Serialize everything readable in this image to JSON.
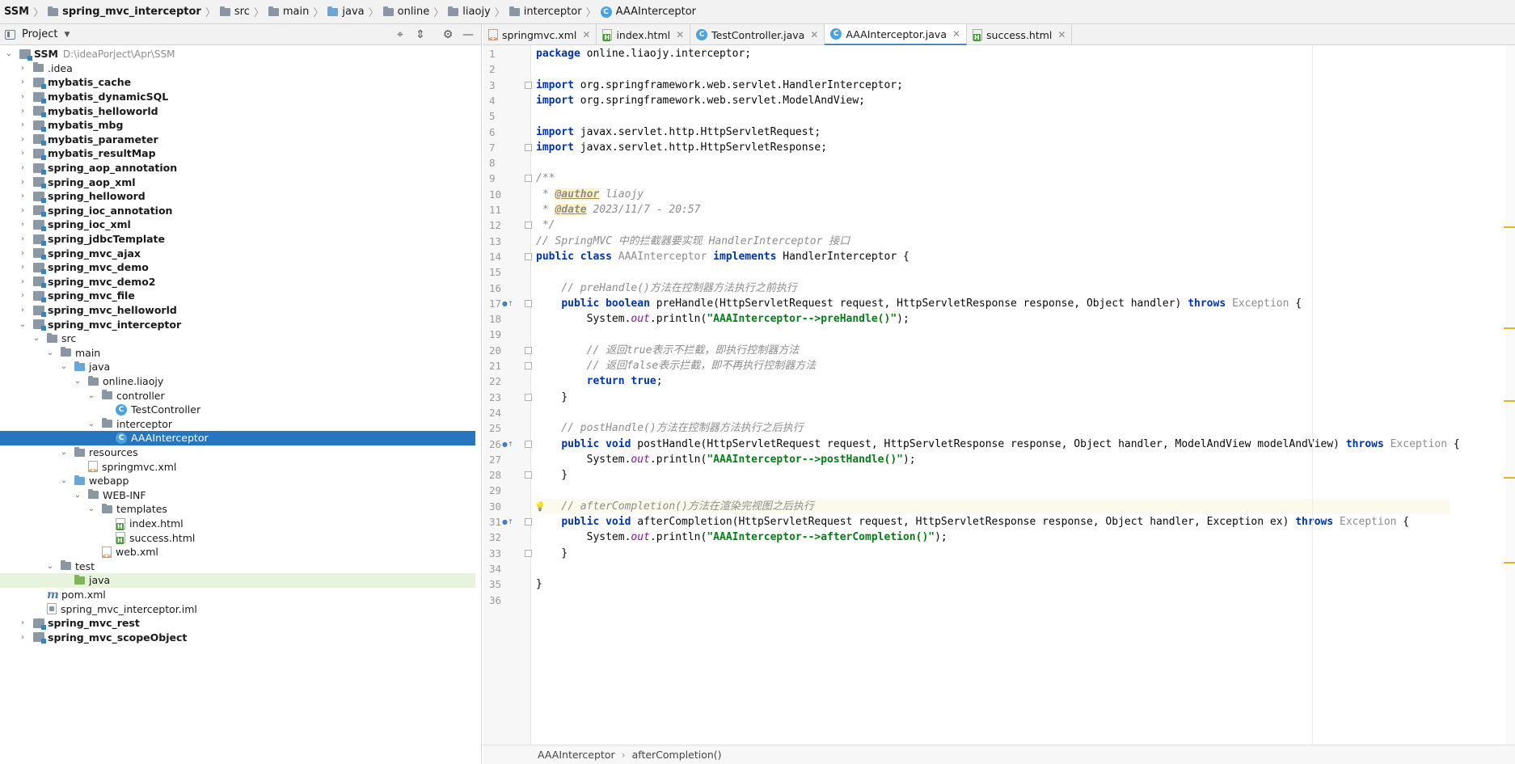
{
  "breadcrumb": [
    {
      "label": "SSM",
      "bold": true,
      "icon": "none"
    },
    {
      "label": "spring_mvc_interceptor",
      "bold": true,
      "icon": "module-folder-icon"
    },
    {
      "label": "src",
      "bold": false,
      "icon": "folder-icon"
    },
    {
      "label": "main",
      "bold": false,
      "icon": "folder-icon"
    },
    {
      "label": "java",
      "bold": false,
      "icon": "source-folder-icon"
    },
    {
      "label": "online",
      "bold": false,
      "icon": "package-icon"
    },
    {
      "label": "liaojy",
      "bold": false,
      "icon": "package-icon"
    },
    {
      "label": "interceptor",
      "bold": false,
      "icon": "package-icon"
    },
    {
      "label": "AAAInterceptor",
      "bold": false,
      "icon": "class-icon"
    }
  ],
  "project_panel": {
    "title": "Project",
    "tree": [
      {
        "label": "SSM",
        "bold": true,
        "depth": 0,
        "expanded": true,
        "icon": "module",
        "hint": "D:\\ideaPorject\\Apr\\SSM"
      },
      {
        "label": ".idea",
        "bold": false,
        "depth": 1,
        "expanded": false,
        "icon": "folder"
      },
      {
        "label": "mybatis_cache",
        "bold": true,
        "depth": 1,
        "expanded": false,
        "icon": "module"
      },
      {
        "label": "mybatis_dynamicSQL",
        "bold": true,
        "depth": 1,
        "expanded": false,
        "icon": "module"
      },
      {
        "label": "mybatis_helloworld",
        "bold": true,
        "depth": 1,
        "expanded": false,
        "icon": "module"
      },
      {
        "label": "mybatis_mbg",
        "bold": true,
        "depth": 1,
        "expanded": false,
        "icon": "module"
      },
      {
        "label": "mybatis_parameter",
        "bold": true,
        "depth": 1,
        "expanded": false,
        "icon": "module"
      },
      {
        "label": "mybatis_resultMap",
        "bold": true,
        "depth": 1,
        "expanded": false,
        "icon": "module"
      },
      {
        "label": "spring_aop_annotation",
        "bold": true,
        "depth": 1,
        "expanded": false,
        "icon": "module"
      },
      {
        "label": "spring_aop_xml",
        "bold": true,
        "depth": 1,
        "expanded": false,
        "icon": "module"
      },
      {
        "label": "spring_helloword",
        "bold": true,
        "depth": 1,
        "expanded": false,
        "icon": "module"
      },
      {
        "label": "spring_ioc_annotation",
        "bold": true,
        "depth": 1,
        "expanded": false,
        "icon": "module"
      },
      {
        "label": "spring_ioc_xml",
        "bold": true,
        "depth": 1,
        "expanded": false,
        "icon": "module"
      },
      {
        "label": "spring_jdbcTemplate",
        "bold": true,
        "depth": 1,
        "expanded": false,
        "icon": "module"
      },
      {
        "label": "spring_mvc_ajax",
        "bold": true,
        "depth": 1,
        "expanded": false,
        "icon": "module"
      },
      {
        "label": "spring_mvc_demo",
        "bold": true,
        "depth": 1,
        "expanded": false,
        "icon": "module"
      },
      {
        "label": "spring_mvc_demo2",
        "bold": true,
        "depth": 1,
        "expanded": false,
        "icon": "module"
      },
      {
        "label": "spring_mvc_file",
        "bold": true,
        "depth": 1,
        "expanded": false,
        "icon": "module"
      },
      {
        "label": "spring_mvc_helloworld",
        "bold": true,
        "depth": 1,
        "expanded": false,
        "icon": "module"
      },
      {
        "label": "spring_mvc_interceptor",
        "bold": true,
        "depth": 1,
        "expanded": true,
        "icon": "module"
      },
      {
        "label": "src",
        "bold": false,
        "depth": 2,
        "expanded": true,
        "icon": "folder"
      },
      {
        "label": "main",
        "bold": false,
        "depth": 3,
        "expanded": true,
        "icon": "folder"
      },
      {
        "label": "java",
        "bold": false,
        "depth": 4,
        "expanded": true,
        "icon": "source-folder"
      },
      {
        "label": "online.liaojy",
        "bold": false,
        "depth": 5,
        "expanded": true,
        "icon": "package"
      },
      {
        "label": "controller",
        "bold": false,
        "depth": 6,
        "expanded": true,
        "icon": "package"
      },
      {
        "label": "TestController",
        "bold": false,
        "depth": 7,
        "leaf": true,
        "icon": "class"
      },
      {
        "label": "interceptor",
        "bold": false,
        "depth": 6,
        "expanded": true,
        "icon": "package"
      },
      {
        "label": "AAAInterceptor",
        "bold": false,
        "depth": 7,
        "leaf": true,
        "icon": "class",
        "selected": true
      },
      {
        "label": "resources",
        "bold": false,
        "depth": 4,
        "expanded": true,
        "icon": "resource-folder"
      },
      {
        "label": "springmvc.xml",
        "bold": false,
        "depth": 5,
        "leaf": true,
        "icon": "xml"
      },
      {
        "label": "webapp",
        "bold": false,
        "depth": 4,
        "expanded": true,
        "icon": "web-folder"
      },
      {
        "label": "WEB-INF",
        "bold": false,
        "depth": 5,
        "expanded": true,
        "icon": "folder"
      },
      {
        "label": "templates",
        "bold": false,
        "depth": 6,
        "expanded": true,
        "icon": "folder"
      },
      {
        "label": "index.html",
        "bold": false,
        "depth": 7,
        "leaf": true,
        "icon": "html"
      },
      {
        "label": "success.html",
        "bold": false,
        "depth": 7,
        "leaf": true,
        "icon": "html"
      },
      {
        "label": "web.xml",
        "bold": false,
        "depth": 6,
        "leaf": true,
        "icon": "xml"
      },
      {
        "label": "test",
        "bold": false,
        "depth": 3,
        "expanded": true,
        "icon": "folder"
      },
      {
        "label": "java",
        "bold": false,
        "depth": 4,
        "leaf": true,
        "icon": "test-folder",
        "highlighted": true
      },
      {
        "label": "pom.xml",
        "bold": false,
        "depth": 2,
        "leaf": true,
        "icon": "maven"
      },
      {
        "label": "spring_mvc_interceptor.iml",
        "bold": false,
        "depth": 2,
        "leaf": true,
        "icon": "iml"
      },
      {
        "label": "spring_mvc_rest",
        "bold": true,
        "depth": 1,
        "expanded": false,
        "icon": "module"
      },
      {
        "label": "spring_mvc_scopeObject",
        "bold": true,
        "depth": 1,
        "expanded": false,
        "icon": "module"
      }
    ]
  },
  "tabs": [
    {
      "label": "springmvc.xml",
      "icon": "xml",
      "active": false
    },
    {
      "label": "index.html",
      "icon": "html",
      "active": false
    },
    {
      "label": "TestController.java",
      "icon": "class",
      "active": false
    },
    {
      "label": "AAAInterceptor.java",
      "icon": "class",
      "active": true
    },
    {
      "label": "success.html",
      "icon": "html",
      "active": false
    }
  ],
  "code_lines": [
    [
      {
        "t": "package",
        "c": "kw"
      },
      {
        "t": " online.liaojy.interceptor;"
      }
    ],
    [],
    [
      {
        "t": "import",
        "c": "kw"
      },
      {
        "t": " org.springframework.web.servlet.HandlerInterceptor;"
      }
    ],
    [
      {
        "t": "import",
        "c": "kw"
      },
      {
        "t": " org.springframework.web.servlet.ModelAndView;"
      }
    ],
    [],
    [
      {
        "t": "import",
        "c": "kw"
      },
      {
        "t": " javax.servlet.http.HttpServletRequest;"
      }
    ],
    [
      {
        "t": "import",
        "c": "kw"
      },
      {
        "t": " javax.servlet.http.HttpServletResponse;"
      }
    ],
    [],
    [
      {
        "t": "/**",
        "c": "cmt"
      }
    ],
    [
      {
        "t": " * ",
        "c": "cmt"
      },
      {
        "t": "@author",
        "c": "doc-tag"
      },
      {
        "t": " liaojy",
        "c": "cmt"
      }
    ],
    [
      {
        "t": " * ",
        "c": "cmt"
      },
      {
        "t": "@date",
        "c": "doc-tag"
      },
      {
        "t": " 2023/11/7 - 20:57",
        "c": "cmt"
      }
    ],
    [
      {
        "t": " */",
        "c": "cmt"
      }
    ],
    [
      {
        "t": "// SpringMVC 中的拦截器要实现 HandlerInterceptor 接口",
        "c": "cmt"
      }
    ],
    [
      {
        "t": "public",
        "c": "kw"
      },
      {
        "t": " "
      },
      {
        "t": "class",
        "c": "kw"
      },
      {
        "t": " "
      },
      {
        "t": "AAAInterceptor",
        "c": "cls-gray"
      },
      {
        "t": " "
      },
      {
        "t": "implements",
        "c": "kw"
      },
      {
        "t": " HandlerInterceptor {"
      }
    ],
    [],
    [
      {
        "t": "    // preHandle()方法在控制器方法执行之前执行",
        "c": "cmt"
      }
    ],
    [
      {
        "t": "    "
      },
      {
        "t": "public",
        "c": "kw"
      },
      {
        "t": " "
      },
      {
        "t": "boolean",
        "c": "kw"
      },
      {
        "t": " preHandle(HttpServletRequest request, HttpServletResponse response, Object handler) "
      },
      {
        "t": "throws",
        "c": "kw"
      },
      {
        "t": " "
      },
      {
        "t": "Exception",
        "c": "gray"
      },
      {
        "t": " {"
      }
    ],
    [
      {
        "t": "        System."
      },
      {
        "t": "out",
        "c": "static"
      },
      {
        "t": ".println("
      },
      {
        "t": "\"AAAInterceptor-->preHandle()\"",
        "c": "str"
      },
      {
        "t": ");"
      }
    ],
    [],
    [
      {
        "t": "        // 返回true表示不拦截，即执行控制器方法",
        "c": "cmt"
      }
    ],
    [
      {
        "t": "        // 返回false表示拦截，即不再执行控制器方法",
        "c": "cmt"
      }
    ],
    [
      {
        "t": "        "
      },
      {
        "t": "return",
        "c": "kw"
      },
      {
        "t": " "
      },
      {
        "t": "true",
        "c": "kw"
      },
      {
        "t": ";"
      }
    ],
    [
      {
        "t": "    }"
      }
    ],
    [],
    [
      {
        "t": "    // postHandle()方法在控制器方法执行之后执行",
        "c": "cmt"
      }
    ],
    [
      {
        "t": "    "
      },
      {
        "t": "public",
        "c": "kw"
      },
      {
        "t": " "
      },
      {
        "t": "void",
        "c": "kw"
      },
      {
        "t": " postHandle(HttpServletRequest request, HttpServletResponse response, Object handler, ModelAndView modelAndView) "
      },
      {
        "t": "throws",
        "c": "kw"
      },
      {
        "t": " "
      },
      {
        "t": "Exception",
        "c": "gray"
      },
      {
        "t": " {"
      }
    ],
    [
      {
        "t": "        System."
      },
      {
        "t": "out",
        "c": "static"
      },
      {
        "t": ".println("
      },
      {
        "t": "\"AAAInterceptor-->postHandle()\"",
        "c": "str"
      },
      {
        "t": ");"
      }
    ],
    [
      {
        "t": "    }"
      }
    ],
    [],
    [
      {
        "t": "    // afterCompletion()方法在渲染完视图之后执行",
        "c": "cmt"
      }
    ],
    [
      {
        "t": "    "
      },
      {
        "t": "public",
        "c": "kw"
      },
      {
        "t": " "
      },
      {
        "t": "void",
        "c": "kw"
      },
      {
        "t": " afterCompletion(HttpServletRequest request, HttpServletResponse response, Object handler, Exception ex) "
      },
      {
        "t": "throws",
        "c": "kw"
      },
      {
        "t": " "
      },
      {
        "t": "Exception",
        "c": "gray"
      },
      {
        "t": " {"
      }
    ],
    [
      {
        "t": "        System."
      },
      {
        "t": "out",
        "c": "static"
      },
      {
        "t": ".println("
      },
      {
        "t": "\"AAAInterceptor-->afterCompletion()\"",
        "c": "str"
      },
      {
        "t": ");"
      }
    ],
    [
      {
        "t": "    }"
      }
    ],
    [],
    [
      {
        "t": "}"
      }
    ],
    []
  ],
  "line_numbers": [
    "1",
    "2",
    "3",
    "4",
    "5",
    "6",
    "7",
    "8",
    "9",
    "10",
    "11",
    "12",
    "13",
    "14",
    "15",
    "16",
    "17",
    "18",
    "19",
    "20",
    "21",
    "22",
    "23",
    "24",
    "25",
    "26",
    "27",
    "28",
    "29",
    "30",
    "31",
    "32",
    "33",
    "34",
    "35",
    "36"
  ],
  "override_marker_lines": [
    17,
    26,
    31
  ],
  "fold_marker_lines": [
    3,
    7,
    9,
    12,
    14,
    17,
    20,
    21,
    23,
    26,
    28,
    31,
    33
  ],
  "caret_line": 30,
  "bulb_line": 30,
  "editor_breadcrumb": [
    "AAAInterceptor",
    "afterCompletion()"
  ],
  "colors": {
    "selection": "#2675bf",
    "keyword": "#0033b3",
    "string": "#067d17",
    "comment": "#8c8c8c",
    "caret_line": "#fcfaed"
  }
}
